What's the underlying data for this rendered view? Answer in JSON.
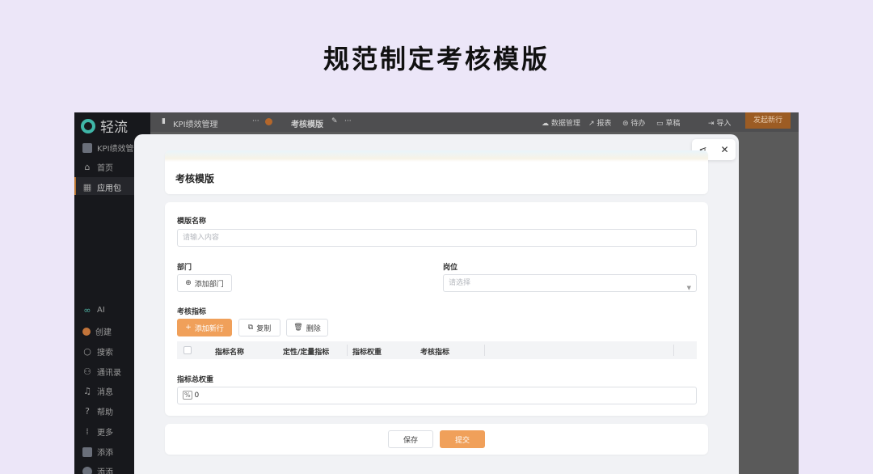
{
  "promo": {
    "title": "规范制定考核模版"
  },
  "sidebar": {
    "logo_text": "轻流",
    "app_name": "KPI绩效管理",
    "items": [
      {
        "label": "首页",
        "icon": "home-icon"
      },
      {
        "label": "应用包",
        "icon": "grid-icon"
      },
      {
        "label": "AI",
        "icon": "ai-icon"
      },
      {
        "label": "创建",
        "icon": "create-icon"
      },
      {
        "label": "搜索",
        "icon": "search-icon"
      },
      {
        "label": "通讯录",
        "icon": "contacts-icon"
      },
      {
        "label": "消息",
        "icon": "bell-icon"
      },
      {
        "label": "帮助",
        "icon": "help-icon"
      },
      {
        "label": "更多",
        "icon": "more-icon"
      },
      {
        "label": "添添",
        "icon": "user-icon"
      },
      {
        "label": "添添",
        "icon": "user-icon"
      }
    ]
  },
  "topbar": {
    "app_tab": "KPI绩效管理",
    "form_tab": "考核模版",
    "actions": [
      "数据管理",
      "报表",
      "待办",
      "草稿",
      "导入"
    ],
    "primary_button": "发起新行"
  },
  "modal": {
    "title": "考核模版",
    "fields": {
      "template_name": {
        "label": "模版名称",
        "placeholder": "请输入内容"
      },
      "department": {
        "label": "部门",
        "button": "添加部门"
      },
      "position": {
        "label": "岗位",
        "placeholder": "请选择"
      },
      "indicators": {
        "label": "考核指标",
        "buttons": {
          "add": "添加新行",
          "copy": "复制",
          "delete": "删除"
        },
        "columns": [
          "指标名称",
          "定性/定量指标",
          "指标权重",
          "考核指标"
        ]
      },
      "total_weight": {
        "label": "指标总权重",
        "value": "0",
        "unit_icon": "percent-icon"
      }
    },
    "footer": {
      "save": "保存",
      "submit": "提交"
    }
  },
  "colors": {
    "accent": "#f0a05a",
    "sidebar_bg": "#17181c",
    "page_bg": "#ece6f8"
  }
}
